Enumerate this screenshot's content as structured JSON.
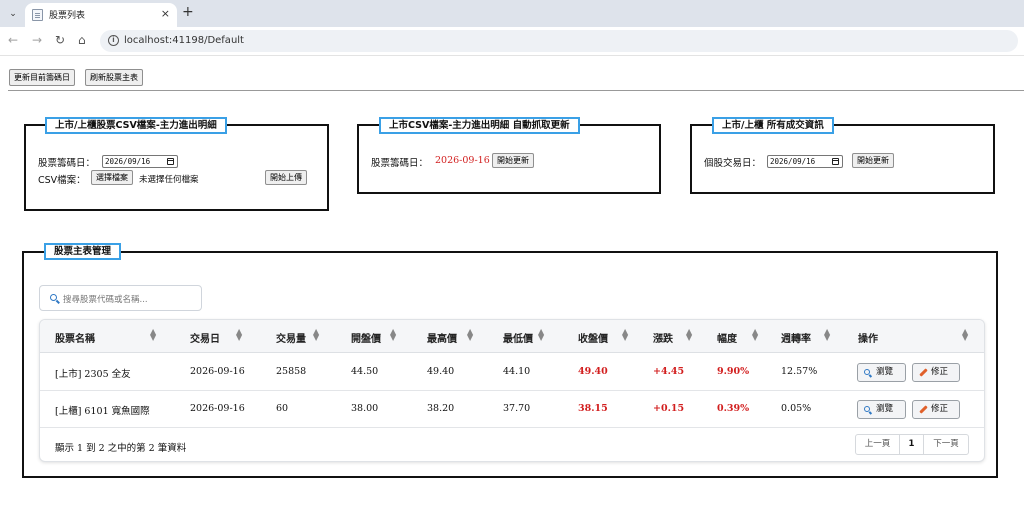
{
  "browser": {
    "tab_title": "股票列表",
    "tab_close": "×",
    "new_tab": "+",
    "url": "localhost:41198/Default"
  },
  "toolbar": {
    "update_date_button": "更新目前籌碼日",
    "refresh_master_button": "刷新股票主表"
  },
  "panel_csv": {
    "legend": "上市/上櫃股票CSV檔案-主力進出明細",
    "date_label": "股票籌碼日：",
    "date_value": "2026/09/16",
    "file_label": "CSV檔案：",
    "choose_file_button": "選擇檔案",
    "no_file_text": "未選擇任何檔案",
    "upload_button": "開始上傳"
  },
  "panel_auto": {
    "legend": "上市CSV檔案-主力進出明細 自動抓取更新",
    "date_label": "股票籌碼日：",
    "date_value": "2026-09-16",
    "update_button": "開始更新"
  },
  "panel_trades": {
    "legend": "上市/上櫃 所有成交資訊",
    "date_label": "個股交易日：",
    "date_value": "2026/09/16",
    "update_button": "開始更新"
  },
  "master": {
    "legend": "股票主表管理",
    "search_placeholder": "搜尋股票代碼或名稱...",
    "columns": [
      "股票名稱",
      "交易日",
      "交易量",
      "開盤價",
      "最高價",
      "最低價",
      "收盤價",
      "漲跌",
      "幅度",
      "週轉率",
      "操作"
    ],
    "rows": [
      {
        "name": "[上市] 2305 全友",
        "date": "2026-09-16",
        "volume": "25858",
        "open": "44.50",
        "high": "49.40",
        "low": "44.10",
        "close": "49.40",
        "change": "+4.45",
        "pct": "9.90%",
        "turnover": "12.57%"
      },
      {
        "name": "[上櫃] 6101 寬魚國際",
        "date": "2026-09-16",
        "volume": "60",
        "open": "38.00",
        "high": "38.20",
        "low": "37.70",
        "close": "38.15",
        "change": "+0.15",
        "pct": "0.39%",
        "turnover": "0.05%"
      }
    ],
    "view_button": "瀏覽",
    "edit_button": "修正",
    "footer_text": "顯示 1 到 2 之中的第 2 筆資料",
    "pager": {
      "prev": "上一頁",
      "current": "1",
      "next": "下一頁"
    }
  },
  "colors": {
    "accent_red": "#d21f1f",
    "legend_border": "#3aa0e6"
  }
}
